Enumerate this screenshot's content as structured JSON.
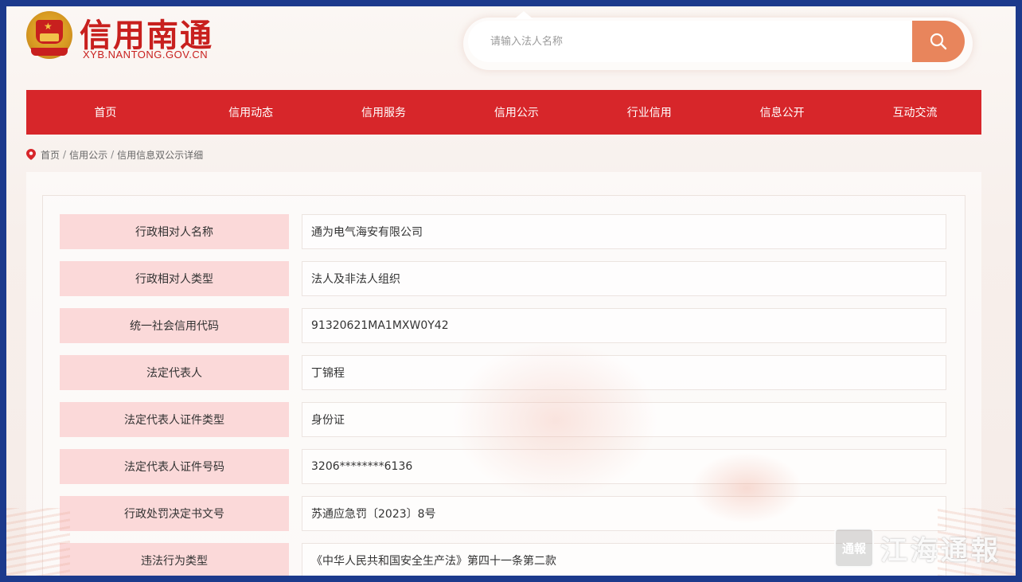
{
  "brand": {
    "title": "信用南通",
    "domain": "XYB.NANTONG.GOV.CN"
  },
  "search": {
    "placeholder": "请输入法人名称",
    "icon": "search-icon"
  },
  "nav": {
    "items": [
      {
        "label": "首页"
      },
      {
        "label": "信用动态"
      },
      {
        "label": "信用服务"
      },
      {
        "label": "信用公示"
      },
      {
        "label": "行业信用"
      },
      {
        "label": "信息公开"
      },
      {
        "label": "互动交流"
      }
    ]
  },
  "breadcrumb": {
    "icon": "location-pin-icon",
    "items": [
      "首页",
      "信用公示",
      "信用信息双公示详细"
    ],
    "separator": "/"
  },
  "details": [
    {
      "label": "行政相对人名称",
      "value": "通为电气海安有限公司"
    },
    {
      "label": "行政相对人类型",
      "value": "法人及非法人组织"
    },
    {
      "label": "统一社会信用代码",
      "value": "91320621MA1MXW0Y42"
    },
    {
      "label": "法定代表人",
      "value": "丁锦程"
    },
    {
      "label": "法定代表人证件类型",
      "value": "身份证"
    },
    {
      "label": "法定代表人证件号码",
      "value": "3206********6136"
    },
    {
      "label": "行政处罚决定书文号",
      "value": "苏通应急罚〔2023〕8号"
    },
    {
      "label": "违法行为类型",
      "value": "《中华人民共和国安全生产法》第四十一条第二款"
    }
  ],
  "watermark": {
    "badge": "通報",
    "text": "江海通報"
  },
  "colors": {
    "nav_bg": "#d7262a",
    "brand_red": "#c8201e",
    "search_button": "#e8855c",
    "label_bg": "#fbd9d9",
    "frame_border": "#1c3a8c"
  }
}
